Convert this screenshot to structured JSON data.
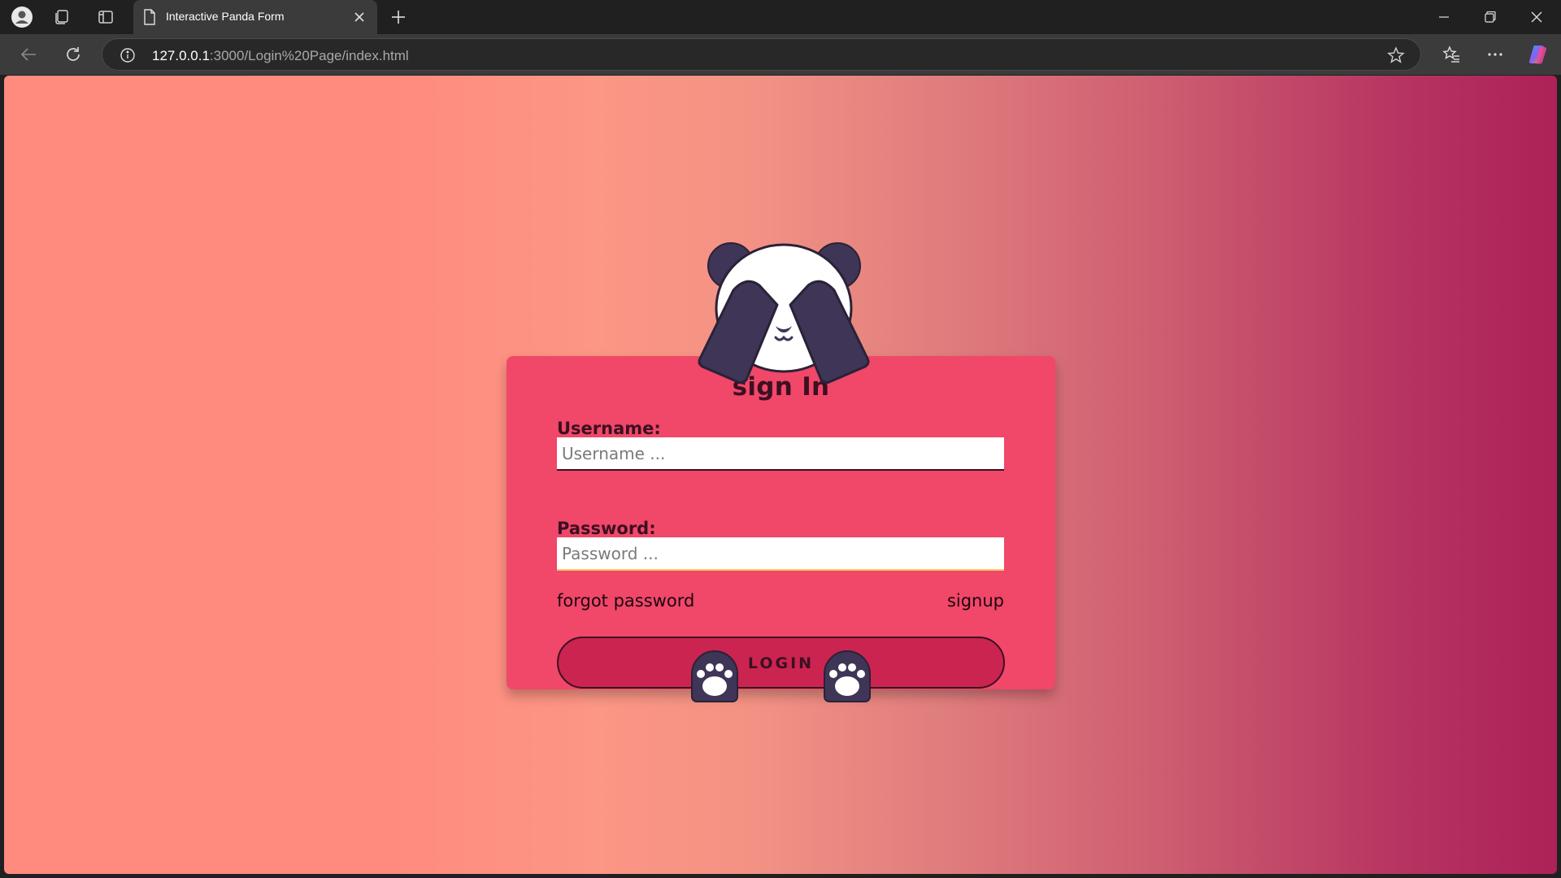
{
  "browser": {
    "tab_title": "Interactive Panda Form",
    "url_host": "127.0.0.1",
    "url_path": ":3000/Login%20Page/index.html"
  },
  "form": {
    "heading": "sign In",
    "username_label": "Username:",
    "username_placeholder": "Username ...",
    "password_label": "Password:",
    "password_placeholder": "Password ...",
    "forgot_link": "forgot password",
    "signup_link": "signup",
    "login_button": "LOGIN"
  },
  "colors": {
    "card": "#f14768",
    "button": "#cc2450",
    "panda_dark": "#3f3557",
    "text_dark": "#3b1022"
  },
  "icons": [
    "profile-icon",
    "collections-icon",
    "sidebar-icon",
    "page-icon",
    "close-icon",
    "plus-icon",
    "minimize-icon",
    "restore-icon",
    "window-close-icon",
    "back-icon",
    "refresh-icon",
    "info-icon",
    "star-icon",
    "favorites-icon",
    "more-icon",
    "copilot-icon"
  ]
}
